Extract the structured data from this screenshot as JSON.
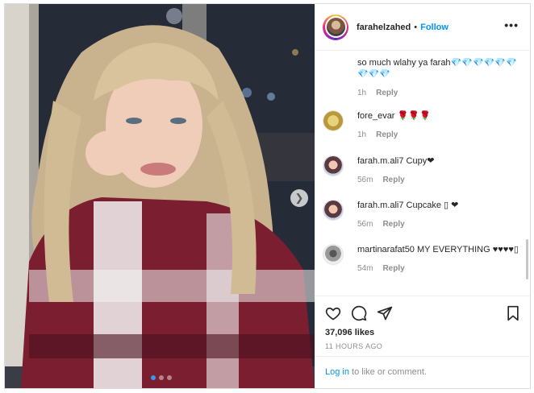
{
  "header": {
    "username": "farahelzahed",
    "separator": "•",
    "follow_label": "Follow",
    "more_label": "•••"
  },
  "comments": [
    {
      "user": "",
      "text": "so much wlahy ya farah�along",
      "time": "1h",
      "reply": "Reply"
    },
    {
      "user": "fore_evar",
      "text": "🌹🌹🌹",
      "time": "1h",
      "reply": "Reply"
    },
    {
      "user": "farah.m.ali7",
      "text": "Cupy❤",
      "time": "56m",
      "reply": "Reply"
    },
    {
      "user": "farah.m.ali7",
      "text": "Cupcake ▯ ❤",
      "time": "56m",
      "reply": "Reply"
    },
    {
      "user": "martinarafat50",
      "text": "MY EVERYTHING ♥♥♥♥▯",
      "time": "54m",
      "reply": "Reply"
    }
  ],
  "post": {
    "likes": "37,096 likes",
    "time_ago": "11 HOURS AGO",
    "login_link": "Log in",
    "login_suffix": " to like or comment."
  },
  "carousel": {
    "next_icon": "chevron-right-icon",
    "page_count": 3,
    "active_page": 1
  },
  "colors": {
    "accent": "#0095f6",
    "muted": "#8e8e8e",
    "text": "#262626",
    "border": "#dbdbdb"
  }
}
